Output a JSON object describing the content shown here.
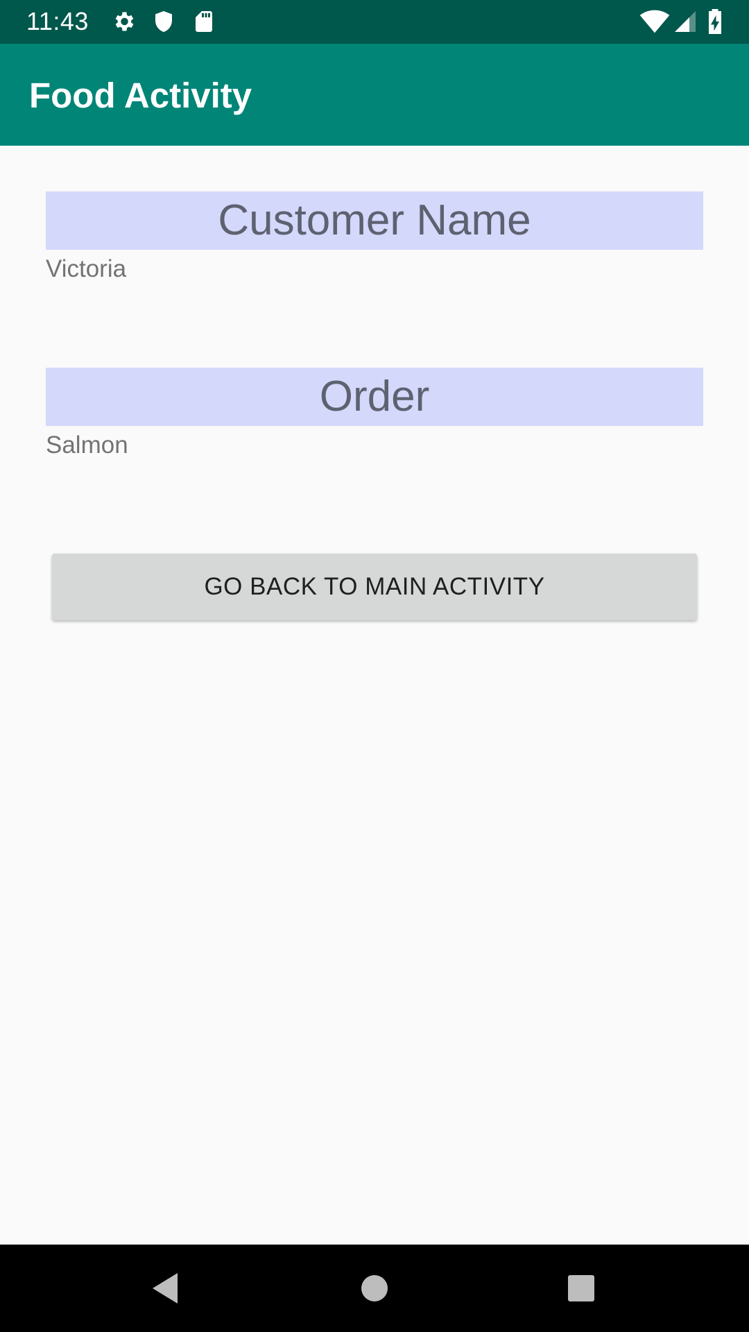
{
  "status_bar": {
    "time": "11:43",
    "left_icons": [
      "gear-icon",
      "shield-icon",
      "sd-card-icon"
    ],
    "right_icons": [
      "wifi-icon",
      "signal-icon",
      "battery-charging-icon"
    ],
    "color": "#00574b"
  },
  "app_bar": {
    "title": "Food Activity",
    "color": "#008577"
  },
  "main": {
    "customer_label": "Customer Name",
    "customer_value": "Victoria",
    "order_label": "Order",
    "order_value": "Salmon",
    "back_button_label": "GO BACK TO MAIN ACTIVITY",
    "label_background": "#d4d8fa"
  },
  "nav_bar": {
    "icons": [
      "back-icon",
      "home-icon",
      "recents-icon"
    ]
  }
}
